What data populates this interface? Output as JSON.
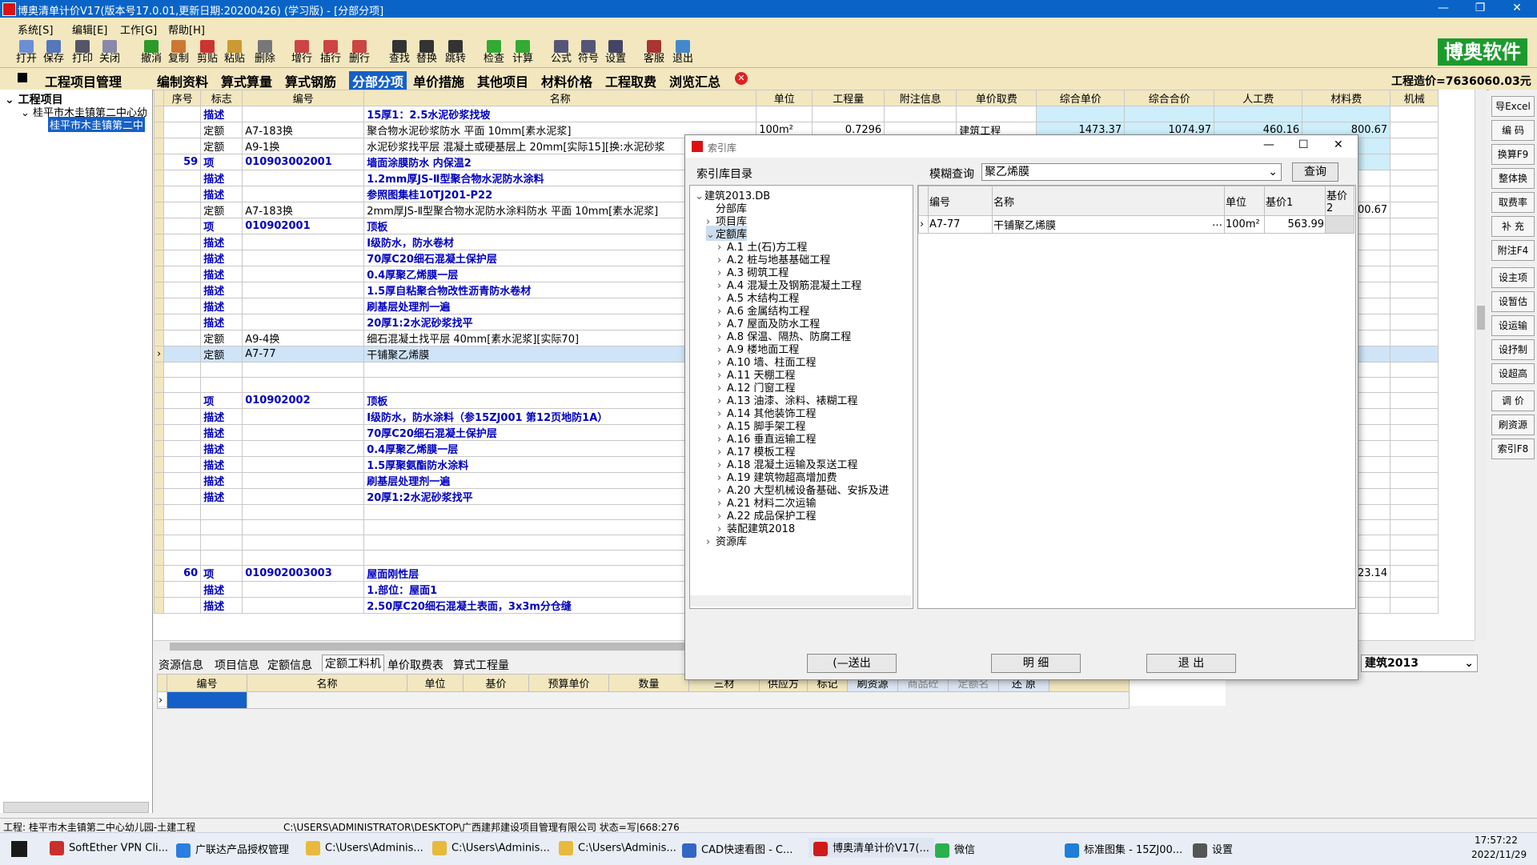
{
  "titlebar": {
    "title": "博奥清单计价V17(版本号17.0.01,更新日期:20200426) (学习版) - [分部分项]",
    "min": "—",
    "max": "❐",
    "close": "✕"
  },
  "menu": [
    "系统[S]",
    "编辑[E]",
    "工作[G]",
    "帮助[H]"
  ],
  "toolbar": [
    "打开",
    "保存",
    "打印",
    "关闭",
    "撤消",
    "复制",
    "剪贴",
    "粘贴",
    "删除",
    "增行",
    "插行",
    "删行",
    "查找",
    "替换",
    "跳转",
    "检查",
    "计算",
    "公式",
    "符号",
    "设置",
    "客服",
    "退出"
  ],
  "brand": "博奥软件",
  "nav": {
    "manage": "工程项目管理",
    "tabs": [
      "编制资料",
      "算式算量",
      "算式钢筋",
      "分部分项",
      "单价措施",
      "其他项目",
      "材料价格",
      "工程取费",
      "浏览汇总"
    ],
    "active_index": 3,
    "total": "工程造价=7636060.03元"
  },
  "tree": {
    "root": "工程项目",
    "child": "桂平市木圭镇第二中心幼",
    "leaf": "桂平市木圭镇第二中"
  },
  "grid": {
    "headers": [
      "序号",
      "标志",
      "编号",
      "名称",
      "单位",
      "工程量",
      "附注信息",
      "单价取费",
      "综合单价",
      "综合合价",
      "人工费",
      "材料费",
      "机械"
    ],
    "rows": [
      {
        "seq": "",
        "flag": "描述",
        "code": "",
        "name": "15厚1：2.5水泥砂浆找坡",
        "unit": "",
        "qty": "",
        "note": "",
        "fee": "",
        "up": "",
        "tp": "",
        "lab": "",
        "mat": "",
        "kind": "desc"
      },
      {
        "seq": "",
        "flag": "定额",
        "code": "A7-183换",
        "name": "聚合物水泥砂浆防水 平面 10mm[素水泥浆]",
        "unit": "100m²",
        "qty": "0.7296",
        "note": "",
        "fee": "建筑工程",
        "up": "1473.37",
        "tp": "1074.97",
        "lab": "460.16",
        "mat": "800.67",
        "kind": "quota"
      },
      {
        "seq": "",
        "flag": "定额",
        "code": "A9-1换",
        "name": "水泥砂浆找平层 混凝土或硬基层上 20mm[实际15][换:水泥砂浆",
        "unit": "",
        "qty": "",
        "note": "",
        "fee": "",
        "up": "",
        "tp": "",
        "lab": "",
        "mat": "",
        "kind": "quota"
      },
      {
        "seq": "59",
        "flag": "项",
        "code": "010903002001",
        "name": "墙面涂膜防水   内保温2",
        "unit": "",
        "qty": "",
        "note": "",
        "fee": "",
        "up": "",
        "tp": "",
        "lab": "",
        "mat": "",
        "kind": "item"
      },
      {
        "seq": "",
        "flag": "描述",
        "code": "",
        "name": "1.2mm厚JS-Ⅱ型聚合物水泥防水涂料",
        "unit": "",
        "qty": "",
        "note": "",
        "fee": "",
        "up": "",
        "tp": "",
        "lab": "",
        "mat": "",
        "kind": "desc"
      },
      {
        "seq": "",
        "flag": "描述",
        "code": "",
        "name": "参照图集桂10TJ201-P22",
        "unit": "",
        "qty": "",
        "note": "",
        "fee": "",
        "up": "",
        "tp": "",
        "lab": "",
        "mat": "",
        "kind": "desc"
      },
      {
        "seq": "",
        "flag": "定额",
        "code": "A7-183换",
        "name": "2mm厚JS-Ⅱ型聚合物水泥防水涂料防水 平面 10mm[素水泥浆]",
        "unit": "",
        "qty": "",
        "note": "",
        "fee": "",
        "up": "",
        "tp": "",
        "lab": "",
        "mat": "800.67",
        "kind": "quota"
      },
      {
        "seq": "",
        "flag": "项",
        "code": "010902001",
        "name": "顶板",
        "unit": "",
        "qty": "",
        "note": "",
        "fee": "",
        "up": "",
        "tp": "",
        "lab": "",
        "mat": "",
        "kind": "item"
      },
      {
        "seq": "",
        "flag": "描述",
        "code": "",
        "name": "Ⅰ级防水，防水卷材",
        "unit": "",
        "qty": "",
        "note": "",
        "fee": "",
        "up": "",
        "tp": "",
        "lab": "",
        "mat": "",
        "kind": "desc"
      },
      {
        "seq": "",
        "flag": "描述",
        "code": "",
        "name": "70厚C20细石混凝土保护层",
        "unit": "",
        "qty": "",
        "note": "",
        "fee": "",
        "up": "",
        "tp": "",
        "lab": "",
        "mat": "",
        "kind": "desc"
      },
      {
        "seq": "",
        "flag": "描述",
        "code": "",
        "name": "0.4厚聚乙烯膜一层",
        "unit": "",
        "qty": "",
        "note": "",
        "fee": "",
        "up": "",
        "tp": "",
        "lab": "",
        "mat": "",
        "kind": "desc"
      },
      {
        "seq": "",
        "flag": "描述",
        "code": "",
        "name": "1.5厚自粘聚合物改性沥青防水卷材",
        "unit": "",
        "qty": "",
        "note": "",
        "fee": "",
        "up": "",
        "tp": "",
        "lab": "",
        "mat": "",
        "kind": "desc"
      },
      {
        "seq": "",
        "flag": "描述",
        "code": "",
        "name": "刷基层处理剂一遍",
        "unit": "",
        "qty": "",
        "note": "",
        "fee": "",
        "up": "",
        "tp": "",
        "lab": "",
        "mat": "",
        "kind": "desc"
      },
      {
        "seq": "",
        "flag": "描述",
        "code": "",
        "name": "20厚1:2水泥砂浆找平",
        "unit": "",
        "qty": "",
        "note": "",
        "fee": "",
        "up": "",
        "tp": "",
        "lab": "",
        "mat": "",
        "kind": "desc"
      },
      {
        "seq": "",
        "flag": "定额",
        "code": "A9-4换",
        "name": "细石混凝土找平层 40mm[素水泥浆][实际70]",
        "unit": "",
        "qty": "",
        "note": "",
        "fee": "",
        "up": "",
        "tp": "",
        "lab": "",
        "mat": "",
        "kind": "quota"
      },
      {
        "seq": "",
        "flag": "定额",
        "code": "A7-77",
        "name": "干铺聚乙烯膜",
        "unit": "",
        "qty": "",
        "note": "",
        "fee": "",
        "up": "",
        "tp": "",
        "lab": "",
        "mat": "",
        "kind": "selected"
      },
      {
        "seq": "",
        "flag": "",
        "code": "",
        "name": "",
        "unit": "",
        "qty": "",
        "note": "",
        "fee": "",
        "up": "",
        "tp": "",
        "lab": "",
        "mat": "",
        "kind": "blank"
      },
      {
        "seq": "",
        "flag": "",
        "code": "",
        "name": "",
        "unit": "",
        "qty": "",
        "note": "",
        "fee": "",
        "up": "",
        "tp": "",
        "lab": "",
        "mat": "",
        "kind": "blank"
      },
      {
        "seq": "",
        "flag": "项",
        "code": "010902002",
        "name": "顶板",
        "unit": "",
        "qty": "",
        "note": "",
        "fee": "",
        "up": "",
        "tp": "",
        "lab": "",
        "mat": "",
        "kind": "item"
      },
      {
        "seq": "",
        "flag": "描述",
        "code": "",
        "name": "Ⅰ级防水，防水涂料（参15ZJ001 第12页地防1A）",
        "unit": "",
        "qty": "",
        "note": "",
        "fee": "",
        "up": "",
        "tp": "",
        "lab": "",
        "mat": "",
        "kind": "desc"
      },
      {
        "seq": "",
        "flag": "描述",
        "code": "",
        "name": "70厚C20细石混凝土保护层",
        "unit": "",
        "qty": "",
        "note": "",
        "fee": "",
        "up": "",
        "tp": "",
        "lab": "",
        "mat": "",
        "kind": "desc"
      },
      {
        "seq": "",
        "flag": "描述",
        "code": "",
        "name": "0.4厚聚乙烯膜一层",
        "unit": "",
        "qty": "",
        "note": "",
        "fee": "",
        "up": "",
        "tp": "",
        "lab": "",
        "mat": "",
        "kind": "desc"
      },
      {
        "seq": "",
        "flag": "描述",
        "code": "",
        "name": "1.5厚聚氨酯防水涂料",
        "unit": "",
        "qty": "",
        "note": "",
        "fee": "",
        "up": "",
        "tp": "",
        "lab": "",
        "mat": "",
        "kind": "desc"
      },
      {
        "seq": "",
        "flag": "描述",
        "code": "",
        "name": "刷基层处理剂一遍",
        "unit": "",
        "qty": "",
        "note": "",
        "fee": "",
        "up": "",
        "tp": "",
        "lab": "",
        "mat": "",
        "kind": "desc"
      },
      {
        "seq": "",
        "flag": "描述",
        "code": "",
        "name": "20厚1:2水泥砂浆找平",
        "unit": "",
        "qty": "",
        "note": "",
        "fee": "",
        "up": "",
        "tp": "",
        "lab": "",
        "mat": "",
        "kind": "desc"
      },
      {
        "seq": "",
        "flag": "",
        "code": "",
        "name": "",
        "unit": "",
        "qty": "",
        "note": "",
        "fee": "",
        "up": "",
        "tp": "",
        "lab": "",
        "mat": "",
        "kind": "blank"
      },
      {
        "seq": "",
        "flag": "",
        "code": "",
        "name": "",
        "unit": "",
        "qty": "",
        "note": "",
        "fee": "",
        "up": "",
        "tp": "",
        "lab": "",
        "mat": "",
        "kind": "blank"
      },
      {
        "seq": "",
        "flag": "",
        "code": "",
        "name": "",
        "unit": "",
        "qty": "",
        "note": "",
        "fee": "",
        "up": "",
        "tp": "",
        "lab": "",
        "mat": "",
        "kind": "blank"
      },
      {
        "seq": "",
        "flag": "",
        "code": "",
        "name": "",
        "unit": "",
        "qty": "",
        "note": "",
        "fee": "",
        "up": "",
        "tp": "",
        "lab": "",
        "mat": "",
        "kind": "blank"
      },
      {
        "seq": "60",
        "flag": "项",
        "code": "010902003003",
        "name": "屋面刚性层",
        "unit": "",
        "qty": "",
        "note": "",
        "fee": "",
        "up": "",
        "tp": "",
        "lab": "",
        "mat": "23.14",
        "kind": "item"
      },
      {
        "seq": "",
        "flag": "描述",
        "code": "",
        "name": "1.部位：屋面1",
        "unit": "",
        "qty": "",
        "note": "",
        "fee": "",
        "up": "",
        "tp": "",
        "lab": "",
        "mat": "",
        "kind": "desc"
      },
      {
        "seq": "",
        "flag": "描述",
        "code": "",
        "name": "2.50厚C20细石混凝土表面，3x3m分仓缝",
        "unit": "",
        "qty": "",
        "note": "",
        "fee": "",
        "up": "",
        "tp": "",
        "lab": "",
        "mat": "",
        "kind": "desc"
      }
    ]
  },
  "right_buttons": [
    "导Excel",
    "编 码",
    "换算F9",
    "整体换",
    "取费率",
    "补 充",
    "附注F4",
    "设主项",
    "设暂估",
    "设运输",
    "设抒制",
    "设超高",
    "调 价",
    "刷资源",
    "索引F8"
  ],
  "bottom_tabs": [
    "资源信息",
    "项目信息",
    "定额信息",
    "定额工料机",
    "单价取费表",
    "算式工程量"
  ],
  "bottom_active": 3,
  "bottom_headers": [
    "编号",
    "名称",
    "单位",
    "基价",
    "预算单价",
    "数量",
    "三材",
    "供应方",
    "标记"
  ],
  "bottom_buttons": [
    "刷资源",
    "商品砼",
    "定额名",
    "还 原"
  ],
  "db_select": "建筑2013",
  "status": {
    "left": "工程: 桂平市木圭镇第二中心幼儿园-土建工程",
    "path": "C:\\USERS\\ADMINISTRATOR\\DESKTOP\\广西建邦建设项目管理有限公司 状态=写|668:276"
  },
  "dialog": {
    "title": "索引库",
    "catalog_label": "索引库目录",
    "search_label": "模糊查询",
    "search_value": "聚乙烯膜",
    "query_btn": "查询",
    "tree": [
      {
        "t": "建筑2013.DB",
        "lvl": 0,
        "exp": "⌄"
      },
      {
        "t": "分部库",
        "lvl": 1,
        "exp": ""
      },
      {
        "t": "项目库",
        "lvl": 1,
        "exp": "›"
      },
      {
        "t": "定额库",
        "lvl": 1,
        "exp": "⌄"
      },
      {
        "t": "A.1 土(石)方工程",
        "lvl": 2,
        "exp": "›"
      },
      {
        "t": "A.2 桩与地基基础工程",
        "lvl": 2,
        "exp": "›"
      },
      {
        "t": "A.3 砌筑工程",
        "lvl": 2,
        "exp": "›"
      },
      {
        "t": "A.4 混凝土及钢筋混凝土工程",
        "lvl": 2,
        "exp": "›"
      },
      {
        "t": "A.5 木结构工程",
        "lvl": 2,
        "exp": "›"
      },
      {
        "t": "A.6 金属结构工程",
        "lvl": 2,
        "exp": "›"
      },
      {
        "t": "A.7 屋面及防水工程",
        "lvl": 2,
        "exp": "›"
      },
      {
        "t": "A.8 保温、隔热、防腐工程",
        "lvl": 2,
        "exp": "›"
      },
      {
        "t": "A.9 楼地面工程",
        "lvl": 2,
        "exp": "›"
      },
      {
        "t": "A.10 墙、柱面工程",
        "lvl": 2,
        "exp": "›"
      },
      {
        "t": "A.11 天棚工程",
        "lvl": 2,
        "exp": "›"
      },
      {
        "t": "A.12 门窗工程",
        "lvl": 2,
        "exp": "›"
      },
      {
        "t": "A.13 油漆、涂料、裱糊工程",
        "lvl": 2,
        "exp": "›"
      },
      {
        "t": "A.14 其他装饰工程",
        "lvl": 2,
        "exp": "›"
      },
      {
        "t": "A.15 脚手架工程",
        "lvl": 2,
        "exp": "›"
      },
      {
        "t": "A.16 垂直运输工程",
        "lvl": 2,
        "exp": "›"
      },
      {
        "t": "A.17 模板工程",
        "lvl": 2,
        "exp": "›"
      },
      {
        "t": "A.18 混凝土运输及泵送工程",
        "lvl": 2,
        "exp": "›"
      },
      {
        "t": "A.19 建筑物超高增加费",
        "lvl": 2,
        "exp": "›"
      },
      {
        "t": "A.20 大型机械设备基础、安拆及进",
        "lvl": 2,
        "exp": "›"
      },
      {
        "t": "A.21 材料二次运输",
        "lvl": 2,
        "exp": "›"
      },
      {
        "t": "A.22 成品保护工程",
        "lvl": 2,
        "exp": "›"
      },
      {
        "t": "装配建筑2018",
        "lvl": 2,
        "exp": "›"
      },
      {
        "t": "资源库",
        "lvl": 1,
        "exp": "›"
      }
    ],
    "table_headers": [
      "编号",
      "名称",
      "单位",
      "基价1",
      "基价2"
    ],
    "result": {
      "code": "A7-77",
      "name": "干铺聚乙烯膜",
      "unit": "100m²",
      "price": "563.99"
    },
    "btn_send": "(—送出",
    "btn_detail": "明 细",
    "btn_exit": "退 出"
  },
  "taskbar": {
    "items": [
      {
        "label": "SoftEther VPN Cli...",
        "color": "#c8302c"
      },
      {
        "label": "广联达产品授权管理",
        "color": "#2a7de1"
      },
      {
        "label": "C:\\Users\\Adminis...",
        "color": "#e8b93a"
      },
      {
        "label": "C:\\Users\\Adminis...",
        "color": "#e8b93a"
      },
      {
        "label": "C:\\Users\\Adminis...",
        "color": "#e8b93a"
      },
      {
        "label": "CAD快速看图 - C...",
        "color": "#3466c4"
      },
      {
        "label": "博奥清单计价V17(...",
        "color": "#d11a1a"
      },
      {
        "label": "微信",
        "color": "#2ab14d"
      },
      {
        "label": "标准图集 - 15ZJ00...",
        "color": "#1d7fd8"
      },
      {
        "label": "设置",
        "color": "#555555"
      }
    ],
    "time": "17:57:22",
    "date": "2022/11/29"
  },
  "colors": {
    "titlebar": "#0a64c8",
    "toolbar_bg": "#f2e7bf",
    "brand": "#1c9b2c",
    "desc_text": "#0000c0",
    "highlight_green": "#22ee22",
    "cyan_cells": "#cdeefa"
  }
}
